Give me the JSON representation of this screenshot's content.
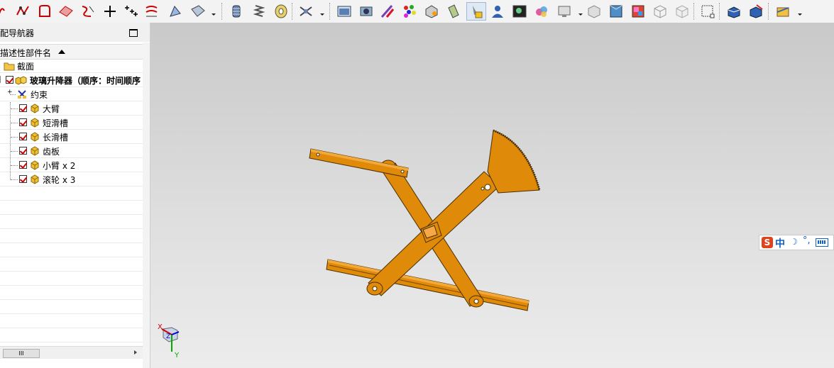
{
  "toolbar": {
    "icons": [
      "curve-icon",
      "spline-icon",
      "sketch-icon",
      "surface-icon",
      "trim-icon",
      "point-icon",
      "point-set-icon",
      "offset-icon",
      "sweep-icon",
      "ruled-surface-icon",
      "more-dropdown-icon",
      "cylinder-icon",
      "spring-icon",
      "bearing-icon",
      "constraint-icon",
      "snapshot-icon",
      "render-icon",
      "material-icon",
      "color-palette-icon",
      "measure-icon",
      "spotlight-icon",
      "highlight-icon",
      "user-icon",
      "image-icon",
      "scene-icon",
      "view-icon",
      "box-icon",
      "shaded-icon",
      "texture-icon",
      "wireframe-box-icon",
      "hidden-line-icon",
      "fit-view-icon",
      "shaded-edges-icon",
      "studio-icon",
      "preferences-icon"
    ]
  },
  "navigator": {
    "title": "配导航器",
    "column_header": "描述性部件名",
    "rows": [
      {
        "label": "截面",
        "icon": "folder-icon",
        "checked": false
      },
      {
        "label": "玻璃升降器（顺序：时间顺序",
        "icon": "assembly-icon",
        "checked": true
      },
      {
        "label": "约束",
        "icon": "constraints-icon",
        "checked": false
      },
      {
        "label": "大臂",
        "icon": "part-icon",
        "checked": true
      },
      {
        "label": "短滑槽",
        "icon": "part-icon",
        "checked": true
      },
      {
        "label": "长滑槽",
        "icon": "part-icon",
        "checked": true
      },
      {
        "label": "齿板",
        "icon": "part-icon",
        "checked": true
      },
      {
        "label": "小臂 x 2",
        "icon": "part-icon",
        "checked": true
      },
      {
        "label": "滚轮 x 3",
        "icon": "part-icon",
        "checked": true
      }
    ],
    "scroll_thumb": "III"
  },
  "viewport": {
    "model_color": "#e08a0a",
    "model_outline": "#4a2f00",
    "axes": {
      "x": "X",
      "y": "Y",
      "z": "Z"
    }
  },
  "ime": {
    "s": "S",
    "mode": "中",
    "moon": "☽",
    "punct": "°,"
  }
}
